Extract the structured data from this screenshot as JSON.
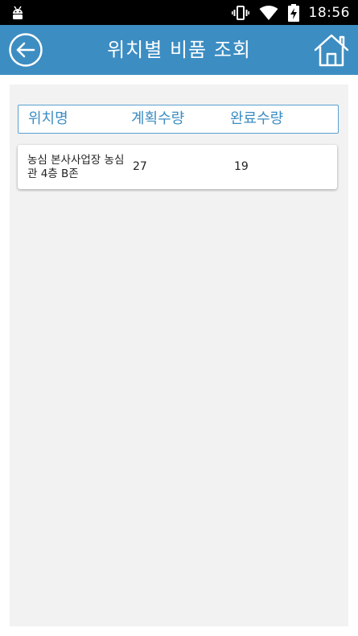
{
  "status_bar": {
    "time": "18:56",
    "icons": [
      "android-icon",
      "vibrate-icon",
      "wifi-icon",
      "battery-charging-icon"
    ]
  },
  "app_bar": {
    "title": "위치별 비품 조회",
    "back_icon": "back-arrow-icon",
    "home_icon": "home-icon",
    "color": "#3c8dc2"
  },
  "table": {
    "headers": {
      "location": "위치명",
      "planned_qty": "계획수량",
      "completed_qty": "완료수량"
    },
    "rows": [
      {
        "location": "농심 본사사업장 농심관 4층 B존",
        "planned_qty": "27",
        "completed_qty": "19"
      }
    ]
  }
}
